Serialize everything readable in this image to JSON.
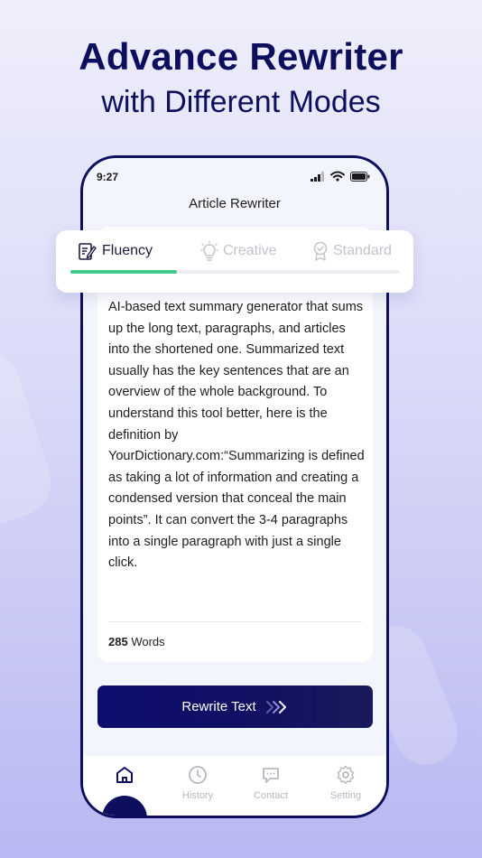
{
  "headline": {
    "title": "Advance Rewriter",
    "subtitle": "with Different Modes"
  },
  "status_bar": {
    "time": "9:27"
  },
  "app": {
    "title": "Article Rewriter"
  },
  "tabs": [
    {
      "label": "Fluency",
      "icon": "edit-note-icon",
      "active": true
    },
    {
      "label": "Creative",
      "icon": "lightbulb-icon",
      "active": false
    },
    {
      "label": "Standard",
      "icon": "badge-icon",
      "active": false
    }
  ],
  "article": {
    "text": "AI-based text summary generator that sums up the long text, paragraphs, and articles into the shortened one. Summarized text usually has the key sentences that are an overview of the whole background. To understand this tool better, here is the definition by YourDictionary.com:“Summarizing is defined as taking a lot of information and creating a condensed version that conceal the main points”. It can convert the 3-4 paragraphs into a single paragraph with just a single click."
  },
  "word_count": {
    "count": "285",
    "label": "Words"
  },
  "rewrite_button": {
    "label": "Rewrite Text"
  },
  "nav": [
    {
      "label": "",
      "icon": "home-icon",
      "active": true
    },
    {
      "label": "History",
      "icon": "clock-icon",
      "active": false
    },
    {
      "label": "Contact",
      "icon": "chat-icon",
      "active": false
    },
    {
      "label": "Setting",
      "icon": "gear-icon",
      "active": false
    }
  ],
  "colors": {
    "primary": "#0d0f5e",
    "accent": "#44c98d",
    "inactive": "#c2c3cb"
  }
}
